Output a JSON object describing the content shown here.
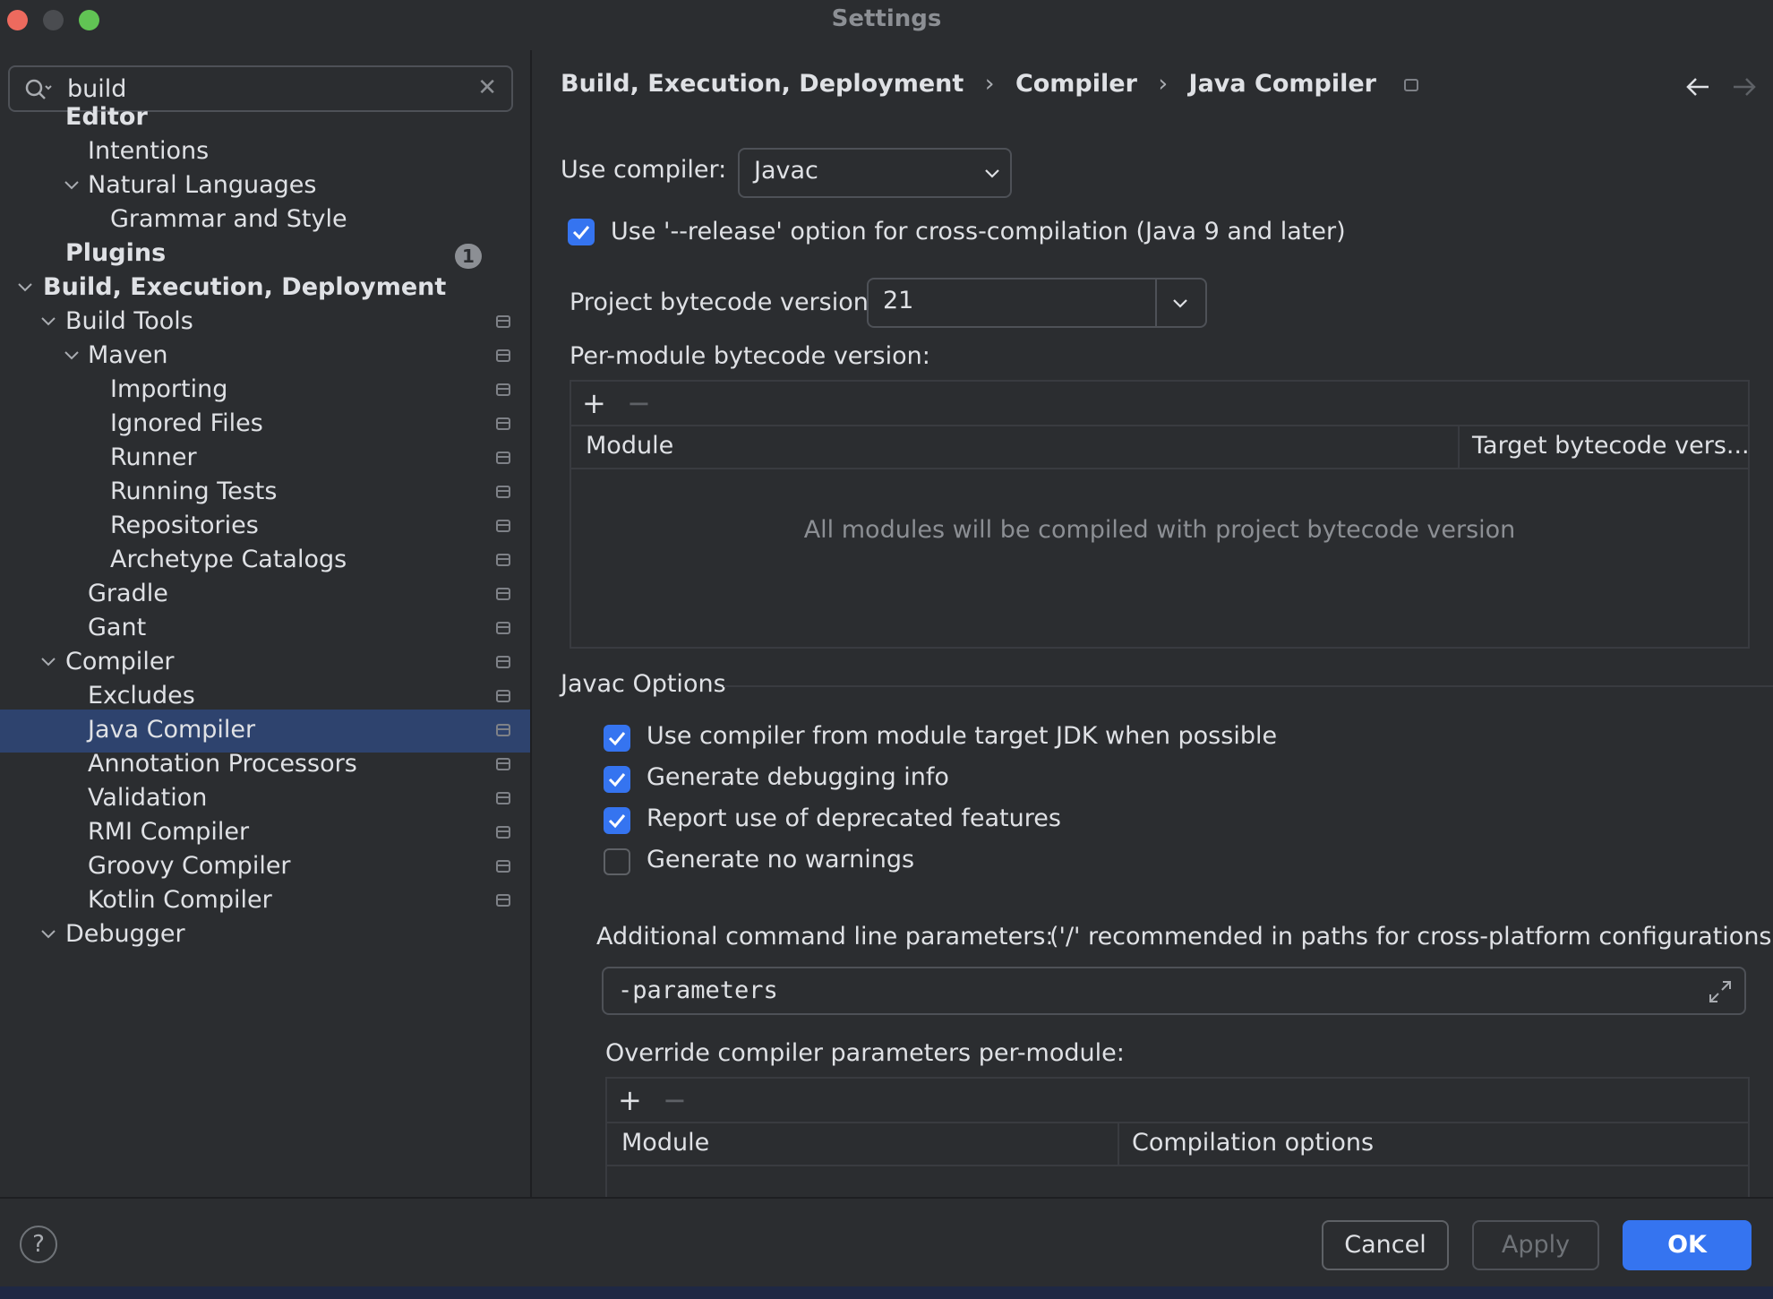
{
  "window": {
    "title": "Settings"
  },
  "search": {
    "value": "build",
    "icon": "search-icon",
    "clear_icon": "close-icon"
  },
  "sidebar": {
    "items": [
      {
        "label": "Editor",
        "bold": true
      },
      {
        "label": "Intentions"
      },
      {
        "label": "Natural Languages",
        "expanded": true
      },
      {
        "label": "Grammar and Style"
      },
      {
        "label": "Plugins",
        "bold": true,
        "badge": "1"
      },
      {
        "label": "Build, Execution, Deployment",
        "bold": true,
        "expanded": true
      },
      {
        "label": "Build Tools",
        "expanded": true
      },
      {
        "label": "Maven",
        "expanded": true
      },
      {
        "label": "Importing"
      },
      {
        "label": "Ignored Files"
      },
      {
        "label": "Runner"
      },
      {
        "label": "Running Tests"
      },
      {
        "label": "Repositories"
      },
      {
        "label": "Archetype Catalogs"
      },
      {
        "label": "Gradle"
      },
      {
        "label": "Gant"
      },
      {
        "label": "Compiler",
        "expanded": true
      },
      {
        "label": "Excludes"
      },
      {
        "label": "Java Compiler",
        "selected": true
      },
      {
        "label": "Annotation Processors"
      },
      {
        "label": "Validation"
      },
      {
        "label": "RMI Compiler"
      },
      {
        "label": "Groovy Compiler"
      },
      {
        "label": "Kotlin Compiler"
      },
      {
        "label": "Debugger",
        "expanded": true
      }
    ]
  },
  "breadcrumb": [
    "Build, Execution, Deployment",
    "Compiler",
    "Java Compiler"
  ],
  "compiler": {
    "use_compiler_label": "Use compiler:",
    "use_compiler_value": "Javac",
    "release_option": {
      "label": "Use '--release' option for cross-compilation (Java 9 and later)",
      "checked": true
    },
    "bytecode_label": "Project bytecode version:",
    "bytecode_value": "21",
    "per_module_label": "Per-module bytecode version:",
    "per_module_table": {
      "columns": [
        "Module",
        "Target bytecode vers..."
      ],
      "empty_text": "All modules will be compiled with project bytecode version"
    }
  },
  "javac": {
    "section_title": "Javac Options",
    "options": [
      {
        "label": "Use compiler from module target JDK when possible",
        "checked": true
      },
      {
        "label": "Generate debugging info",
        "checked": true
      },
      {
        "label": "Report use of deprecated features",
        "checked": true
      },
      {
        "label": "Generate no warnings",
        "checked": false
      }
    ],
    "cmd_label": "Additional command line parameters:",
    "cmd_hint": "('/' recommended in paths for cross-platform configurations)",
    "cmd_value": "-parameters",
    "override_label": "Override compiler parameters per-module:",
    "override_table": {
      "columns": [
        "Module",
        "Compilation options"
      ]
    }
  },
  "toolbar": {
    "add": "+",
    "remove": "−"
  },
  "footer": {
    "help": "?",
    "cancel": "Cancel",
    "apply": "Apply",
    "ok": "OK"
  },
  "colors": {
    "accent": "#3574f0",
    "selection": "#2e436e",
    "background": "#2b2d30"
  }
}
